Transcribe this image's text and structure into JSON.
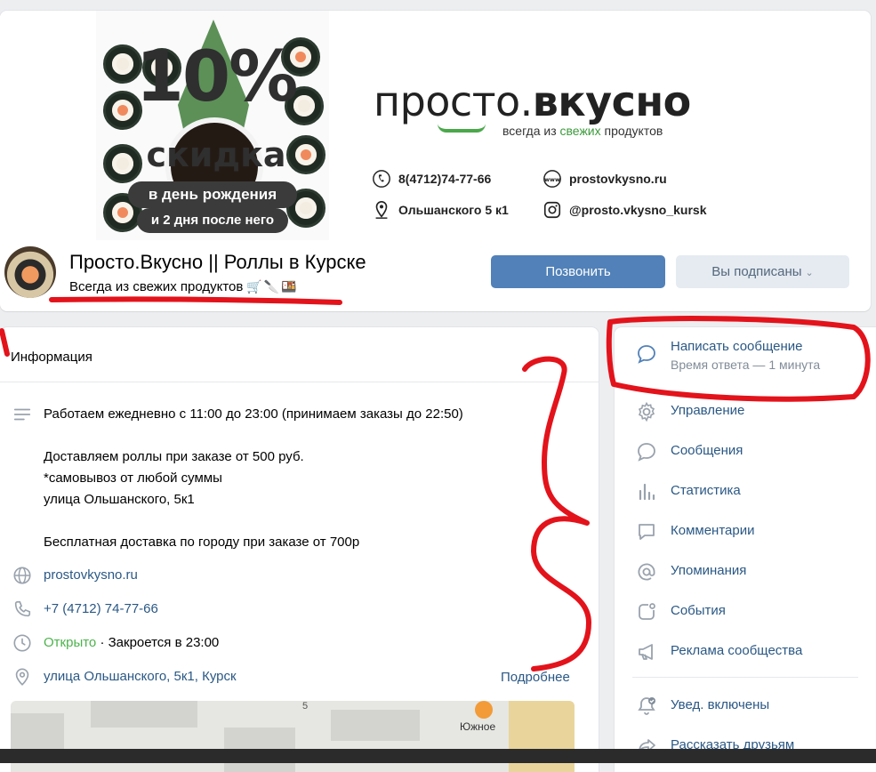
{
  "cover": {
    "promo_big": "10%",
    "promo_sub": "скидка",
    "promo_pill1": "в день рождения",
    "promo_pill2": "и 2 дня после него",
    "brand_light": "просто.",
    "brand_bold": "вкусно",
    "tagline_pre": "всегда из ",
    "tagline_green": "свежих",
    "tagline_post": " продуктов",
    "contacts": {
      "phone": "8(4712)74-77-66",
      "site": "prostovkysno.ru",
      "address": "Ольшанского 5 к1",
      "instagram": "@prosto.vkysno_kursk"
    }
  },
  "group": {
    "name": "Просто.Вкусно || Роллы в Курске",
    "status": "Всегда из свежих продуктов",
    "status_emoji": "🛒🔪🍱",
    "call_label": "Позвонить",
    "subscribed_label": "Вы подписаны"
  },
  "info": {
    "title": "Информация",
    "description": "Работаем ежедневно с 11:00 до 23:00 (принимаем заказы до 22:50)\n\nДоставляем роллы при заказе от 500 руб.\n*самовывоз от любой суммы\nулица Ольшанского, 5к1\n\nБесплатная доставка по городу при заказе от 700р",
    "website": "prostovkysno.ru",
    "phone": "+7 (4712) 74-77-66",
    "open_status": "Открыто",
    "closes": " · Закроется в 23:00",
    "address": "улица Ольшанского, 5к1, Курск",
    "more": "Подробнее",
    "map_number": "5",
    "map_place": "Южное"
  },
  "sidebar": {
    "write_message": "Написать сообщение",
    "response_time": "Время ответа — 1 минута",
    "items": [
      {
        "label": "Управление",
        "icon": "gear-icon"
      },
      {
        "label": "Сообщения",
        "icon": "message-icon"
      },
      {
        "label": "Статистика",
        "icon": "stats-icon"
      },
      {
        "label": "Комментарии",
        "icon": "comments-icon"
      },
      {
        "label": "Упоминания",
        "icon": "mention-icon"
      },
      {
        "label": "События",
        "icon": "events-icon"
      },
      {
        "label": "Реклама сообщества",
        "icon": "megaphone-icon"
      },
      {
        "label": "Увед. включены",
        "icon": "bell-check-icon"
      },
      {
        "label": "Рассказать друзьям",
        "icon": "share-icon"
      }
    ]
  },
  "colors": {
    "accent": "#5181b8",
    "link": "#2a5885",
    "annotation": "#e3131b",
    "open_green": "#4bb34b"
  }
}
